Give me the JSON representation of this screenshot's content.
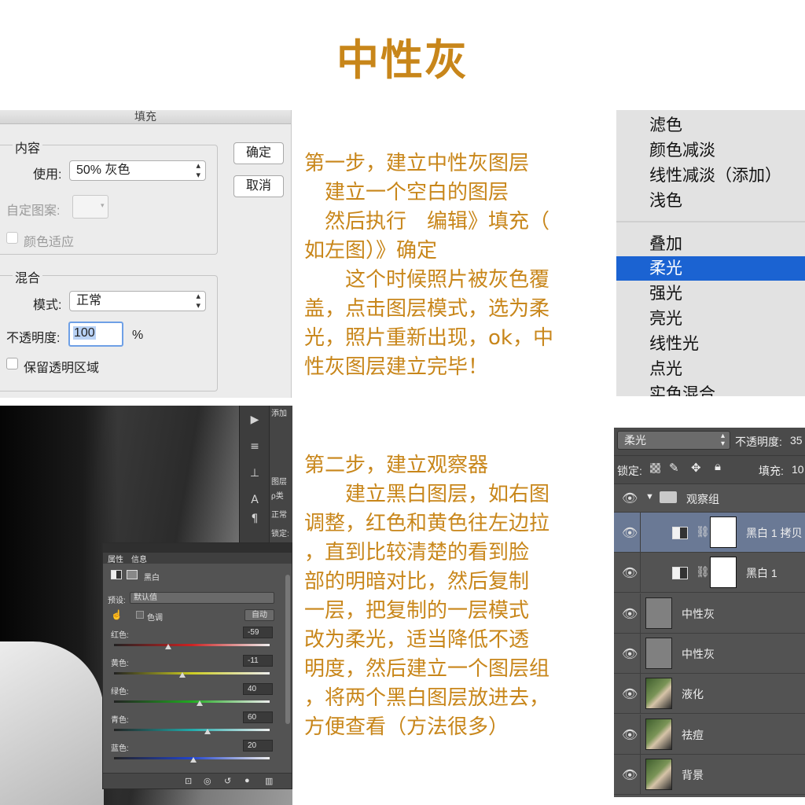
{
  "page_title": "中性灰",
  "step1": {
    "lines": [
      "第一步，建立中性灰图层",
      "　建立一个空白的图层",
      "　然后执行　编辑》填充（",
      "如左图）》确定",
      "　　这个时候照片被灰色覆",
      "盖，点击图层模式，选为柔",
      "光，照片重新出现，ok，中",
      "性灰图层建立完毕！"
    ]
  },
  "step2": {
    "lines": [
      "第二步，建立观察器",
      "　　建立黑白图层，如右图",
      "调整，红色和黄色往左边拉",
      "，直到比较清楚的看到脸",
      "部的明暗对比，然后复制",
      "一层，把复制的一层模式",
      "改为柔光，适当降低不透",
      "明度，然后建立一个图层组",
      "，将两个黑白图层放进去，",
      "方便查看（方法很多）"
    ]
  },
  "fill_dialog": {
    "window_title": "填充",
    "content_group": "内容",
    "use_label": "使用:",
    "use_value": "50% 灰色",
    "custom_pattern_label": "自定图案:",
    "color_adapt_label": "颜色适应",
    "blend_group": "混合",
    "mode_label": "模式:",
    "mode_value": "正常",
    "opacity_label": "不透明度:",
    "opacity_value": "100",
    "opacity_unit": "%",
    "preserve_label": "保留透明区域",
    "ok_label": "确定",
    "cancel_label": "取消"
  },
  "blend_menu": {
    "group_a": [
      "滤色",
      "颜色减淡",
      "线性减淡（添加）",
      "浅色"
    ],
    "group_b": [
      "叠加",
      "柔光",
      "强光",
      "亮光",
      "线性光",
      "点光",
      "实色混合"
    ],
    "selected": "柔光"
  },
  "photoshop_side": {
    "panel_tab": "图层",
    "search": "ρ类",
    "mode": "正常",
    "lock": "锁定:",
    "top_label": "添加"
  },
  "bw_panel": {
    "tab_properties": "属性",
    "tab_info": "信息",
    "title": "黑白",
    "preset_label": "预设:",
    "preset_value": "默认值",
    "tint_label": "色调",
    "auto_label": "自动",
    "sliders": [
      {
        "label": "红色:",
        "value": "-59",
        "pos": 0.35,
        "color": "#cc2222"
      },
      {
        "label": "黄色:",
        "value": "-11",
        "pos": 0.44,
        "color": "#cccc22"
      },
      {
        "label": "绿色:",
        "value": "40",
        "pos": 0.55,
        "color": "#22aa22"
      },
      {
        "label": "青色:",
        "value": "60",
        "pos": 0.6,
        "color": "#22aaaa"
      },
      {
        "label": "蓝色:",
        "value": "20",
        "pos": 0.51,
        "color": "#2244cc"
      }
    ]
  },
  "layers_panel": {
    "blend_mode": "柔光",
    "opacity_label": "不透明度:",
    "opacity_value": "35",
    "lock_label": "锁定:",
    "fill_label": "填充:",
    "fill_value": "10",
    "group_name": "观察组",
    "layers": [
      {
        "name": "黑白 1 拷贝",
        "kind": "adjust",
        "selected": true
      },
      {
        "name": "黑白 1",
        "kind": "adjust",
        "selected": false
      },
      {
        "name": "中性灰",
        "kind": "gray",
        "selected": false
      },
      {
        "name": "中性灰",
        "kind": "gray",
        "selected": false
      },
      {
        "name": "液化",
        "kind": "photo",
        "selected": false
      },
      {
        "name": "祛痘",
        "kind": "photo",
        "selected": false
      },
      {
        "name": "背景",
        "kind": "photo",
        "selected": false
      }
    ]
  }
}
